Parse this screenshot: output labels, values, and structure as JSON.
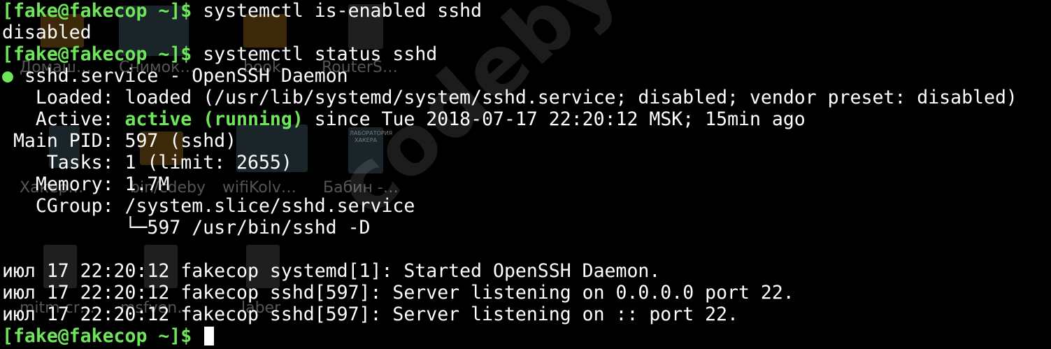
{
  "terminal": {
    "prompt": "[fake@fakecop ~]$",
    "cmd1": "systemctl is-enabled sshd",
    "out1": "disabled",
    "cmd2": "systemctl status sshd",
    "unit_bullet": "●",
    "unit_line": "sshd.service - OpenSSH Daemon",
    "loaded_label": "   Loaded:",
    "loaded_value": "loaded (/usr/lib/systemd/system/sshd.service; disabled; vendor preset: disabled)",
    "active_label": "   Active:",
    "active_state": "active (running)",
    "active_since": "since Tue 2018-07-17 22:20:12 MSK; 15min ago",
    "mainpid_label": " Main PID:",
    "mainpid_value": "597 (sshd)",
    "tasks_label": "    Tasks:",
    "tasks_value": "1 (limit: 2655)",
    "memory_label": "   Memory:",
    "memory_value": "1.7M",
    "cgroup_label": "   CGroup:",
    "cgroup_value": "/system.slice/sshd.service",
    "cgroup_child": "           └─597 /usr/bin/sshd -D",
    "logs": [
      "июл 17 22:20:12 fakecop systemd[1]: Started OpenSSH Daemon.",
      "июл 17 22:20:12 fakecop sshd[597]: Server listening on 0.0.0.0 port 22.",
      "июл 17 22:20:12 fakecop sshd[597]: Server listening on :: port 22."
    ]
  },
  "desktop_background": {
    "icon_labels": [
      "Домаш…",
      "Снимок…",
      "book",
      "RouterS…",
      "Хакер…",
      "bin/cdeby",
      "wifiKolv…",
      "Бабин -…",
      "mitm cr…",
      "msfven…",
      "laber"
    ],
    "book_cover_text": "ЛАБОРАТОРИЯ ХАКЕРА",
    "watermark": "codeby.net"
  },
  "colors": {
    "background": "#000000",
    "text": "#ffffff",
    "accent_green": "#6ee65a"
  }
}
